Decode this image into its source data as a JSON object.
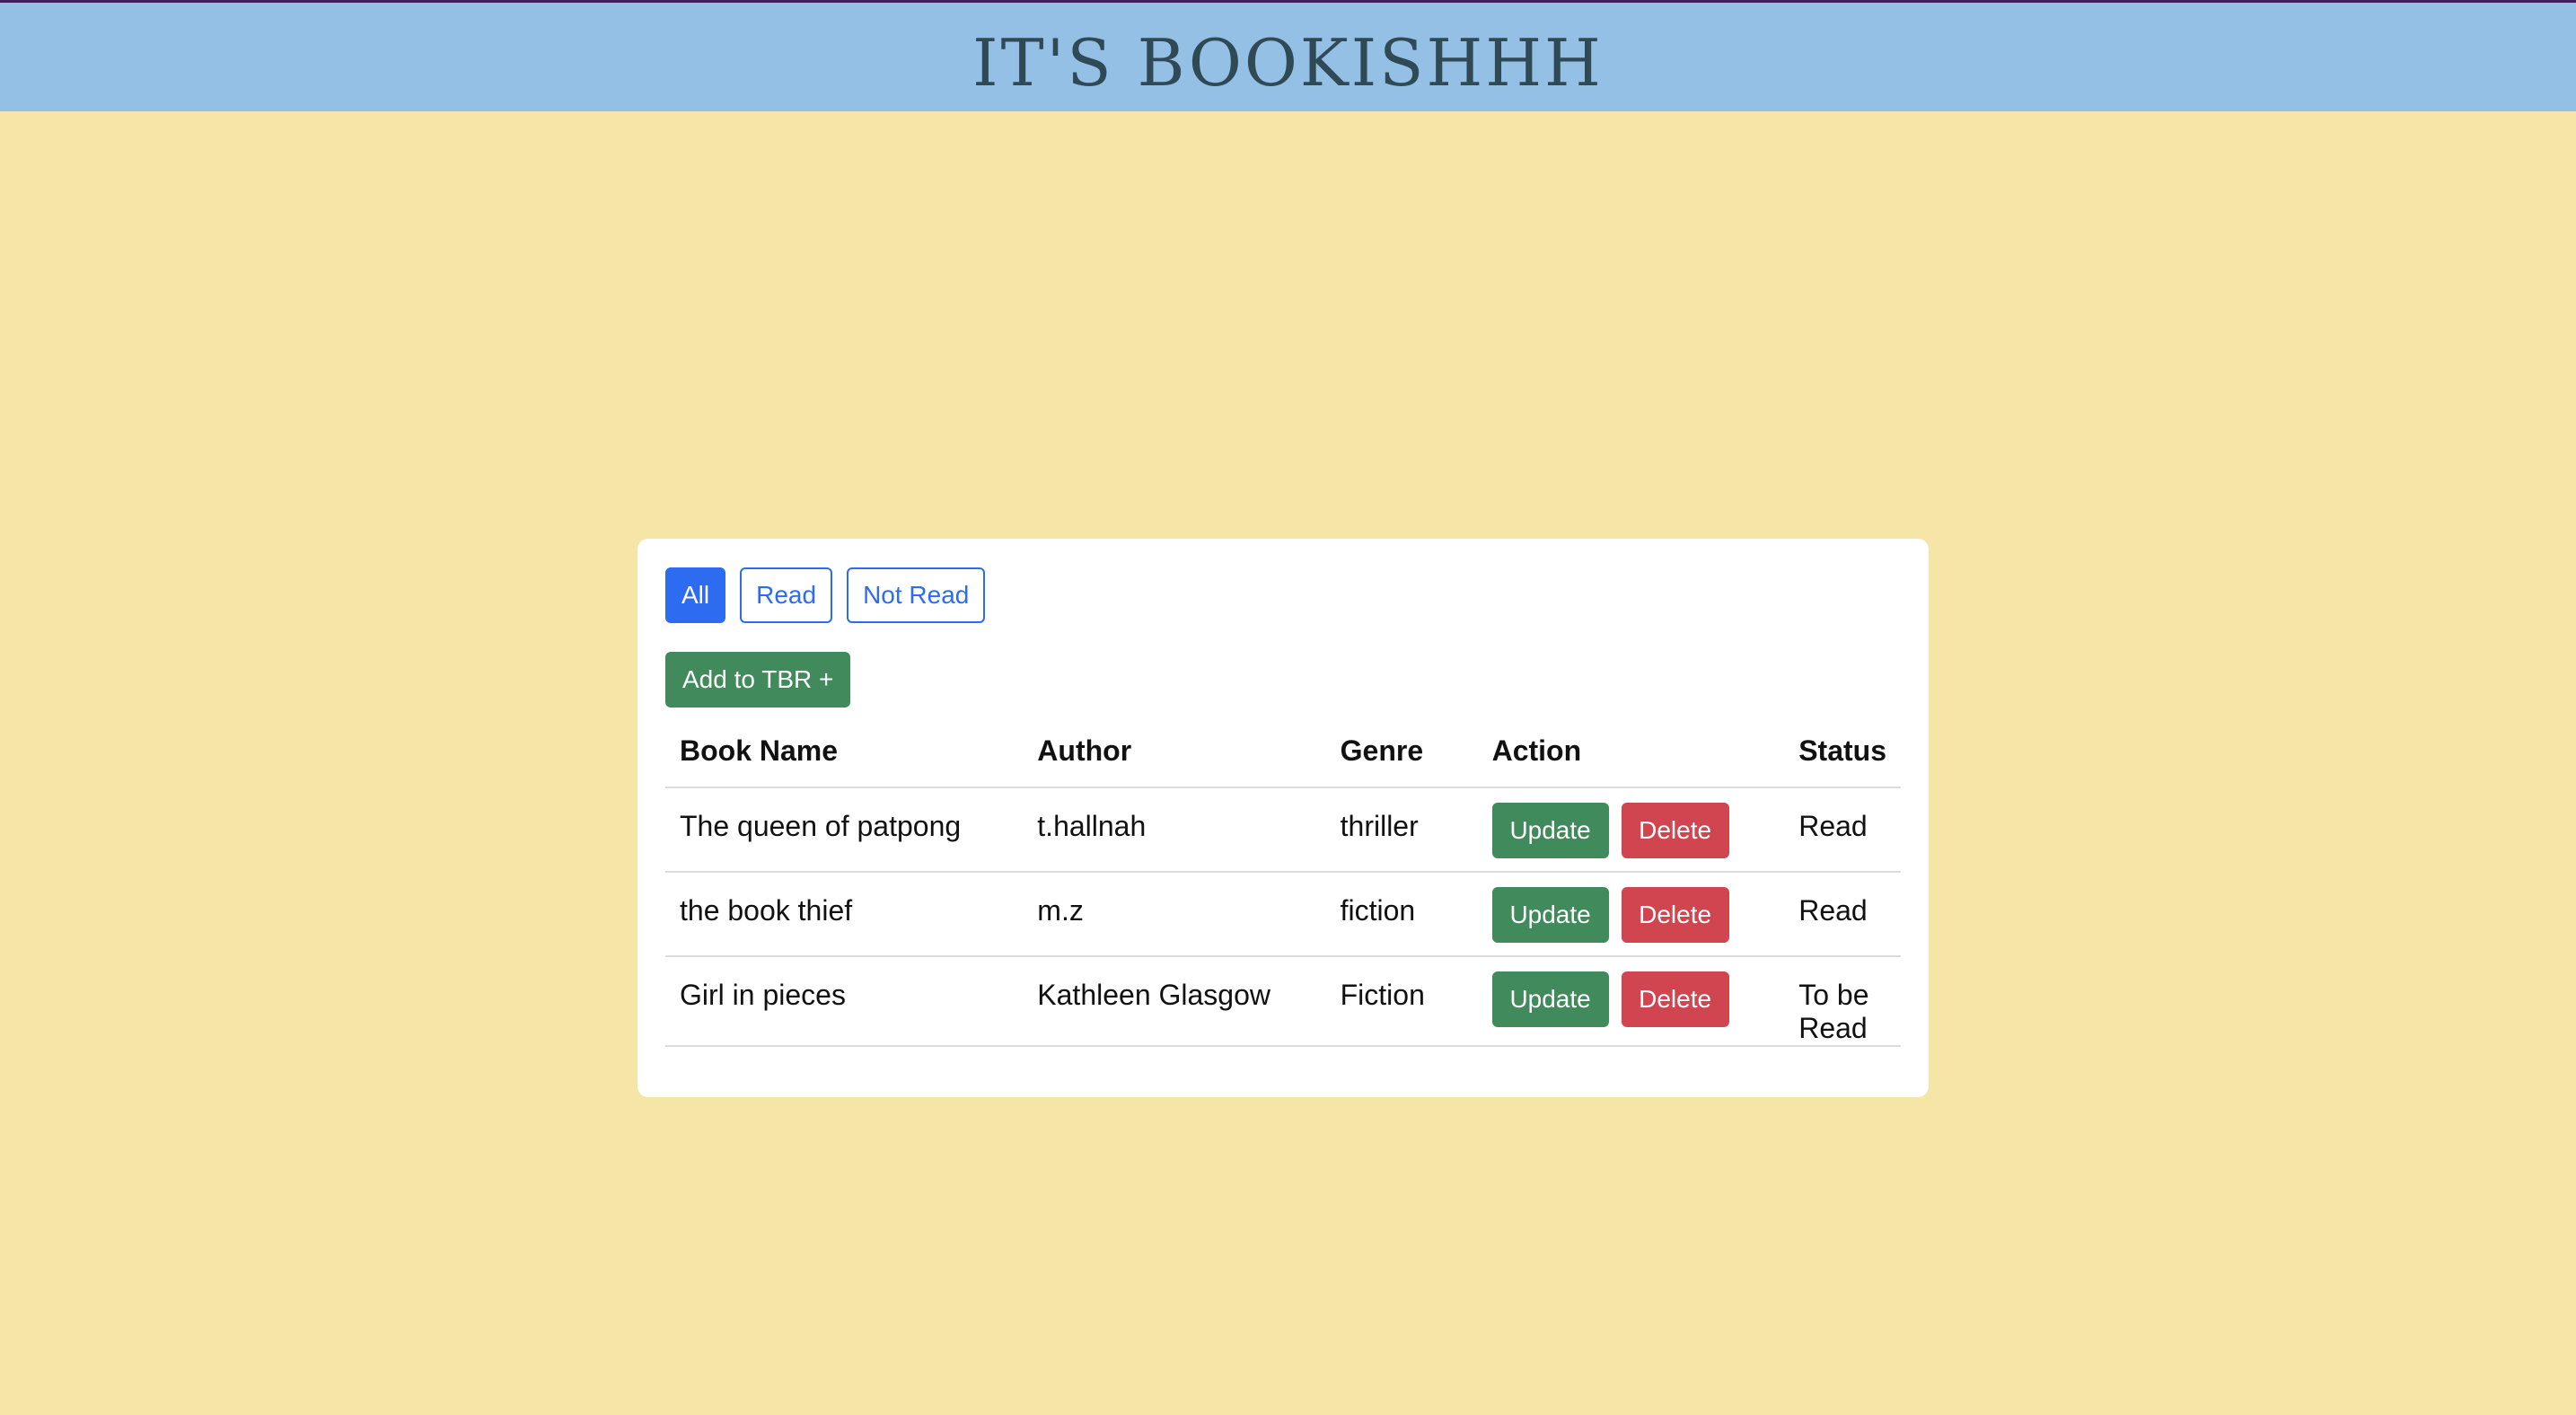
{
  "header": {
    "title": "IT'S BOOKISHHH"
  },
  "filters": {
    "all": "All",
    "read": "Read",
    "not_read": "Not Read",
    "active": "All"
  },
  "add_button": "Add to TBR +",
  "table": {
    "headers": {
      "book_name": "Book Name",
      "author": "Author",
      "genre": "Genre",
      "action": "Action",
      "status": "Status"
    },
    "rows": [
      {
        "book_name": "The queen of patpong",
        "author": "t.hallnah",
        "genre": "thriller",
        "update": "Update",
        "delete": "Delete",
        "status": "Read"
      },
      {
        "book_name": "the book thief",
        "author": "m.z",
        "genre": "fiction",
        "update": "Update",
        "delete": "Delete",
        "status": "Read"
      },
      {
        "book_name": "Girl in pieces",
        "author": "Kathleen Glasgow",
        "genre": "Fiction",
        "update": "Update",
        "delete": "Delete",
        "status": "To be Read"
      }
    ]
  },
  "colors": {
    "page_background": "#f5e6a8",
    "header_background": "#94c0e6",
    "primary_blue": "#2d6cf0",
    "success_green": "#418a5b",
    "danger_red": "#d0454f"
  }
}
